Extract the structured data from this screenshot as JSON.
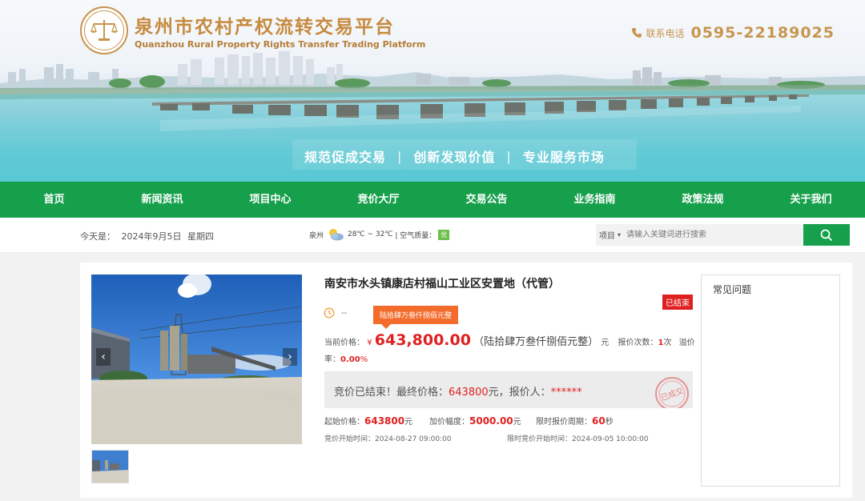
{
  "header": {
    "title": "泉州市农村产权流转交易平台",
    "subtitle": "Quanzhou Rural Property Rights Transfer Trading Platform",
    "phone_label": "联系电话",
    "phone": "0595-22189025",
    "slogans": [
      "规范促成交易",
      "创新发现价值",
      "专业服务市场"
    ],
    "slogan_sep": "|",
    "brand_color": "#c8954e"
  },
  "nav": {
    "items": [
      "首页",
      "新闻资讯",
      "项目中心",
      "竞价大厅",
      "交易公告",
      "业务指南",
      "政策法规",
      "关于我们"
    ],
    "color": "#17a04c"
  },
  "infobar": {
    "today_label": "今天是：",
    "date": "2024年9月5日",
    "weekday": "星期四",
    "city": "泉州",
    "temp": "28℃ ~ 32℃",
    "aq_label": "| 空气质量：",
    "aq_value": "优"
  },
  "search": {
    "select_value": "项目",
    "select_arrow": "▾",
    "placeholder": "请输入关键词进行搜索"
  },
  "project": {
    "title": "南安市水头镇康店村福山工业区安置地（代管）",
    "status": "已结束",
    "time_value": "--",
    "tooltip": "陆拾肆万叁仟捌佰元整",
    "price_label": "当前价格：",
    "currency": "¥",
    "price": "643,800.00",
    "price_cn": "（陆拾肆万叁仟捌佰元整）",
    "unit": "元",
    "bid_count_label": "报价次数：",
    "bid_count": "1",
    "bid_count_unit": "次",
    "premium_label_a": "溢价",
    "premium_label_b": "率：",
    "premium": "0.00",
    "premium_unit": "%",
    "result_prefix": "竞价已结束！最终价格：",
    "final_price": "643800",
    "result_mid": "元，报价人：",
    "bidder": "******",
    "seal_text": "已成交",
    "start_price_label": "起始价格：",
    "start_price": "643800",
    "start_price_unit": "元",
    "increment_label": "加价幅度：",
    "increment": "5000.00",
    "increment_unit": "元",
    "period_label": "限时报价周期：",
    "period": "60",
    "period_unit": "秒",
    "start_time_label": "竞价开始时间：",
    "start_time": "2024-08-27 09:00:00",
    "limit_time_label": "限时竞价开始时间：",
    "limit_time": "2024-09-05 10:00:00"
  },
  "faq": {
    "title": "常见问题"
  },
  "icons": {
    "logo": "scales-of-justice-icon",
    "phone": "phone-icon",
    "weather": "partly-cloudy-icon",
    "search": "search-icon",
    "clock": "clock-icon",
    "prev": "chevron-left-icon",
    "next": "chevron-right-icon"
  },
  "colors": {
    "accent_red": "#e02020",
    "tooltip_orange": "#f36c2b",
    "green": "#17a04c"
  }
}
